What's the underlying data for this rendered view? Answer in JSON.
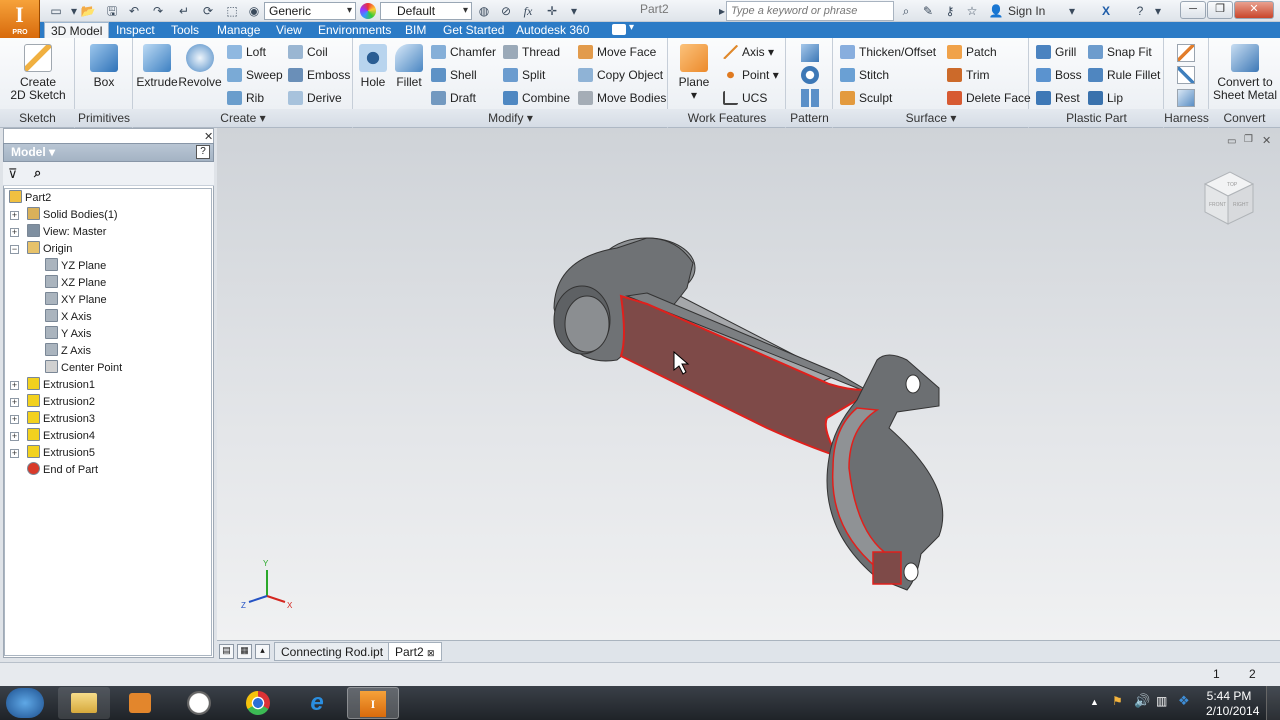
{
  "app": {
    "logo": "I",
    "logo_sub": "PRO",
    "doc_title": "Part2"
  },
  "quick_access": {
    "material": "Generic",
    "appearance": "Default",
    "search_placeholder": "Type a keyword or phrase",
    "sign_in": "Sign In"
  },
  "tabs": [
    "3D Model",
    "Inspect",
    "Tools",
    "Manage",
    "View",
    "Environments",
    "BIM",
    "Get Started",
    "Autodesk 360"
  ],
  "active_tab": "3D Model",
  "ribbon": {
    "sketch": {
      "label": "Sketch",
      "create": "Create\n2D Sketch"
    },
    "primitives": {
      "label": "Primitives",
      "box": "Box"
    },
    "create": {
      "label": "Create",
      "extrude": "Extrude",
      "revolve": "Revolve",
      "loft": "Loft",
      "sweep": "Sweep",
      "rib": "Rib",
      "coil": "Coil",
      "emboss": "Emboss",
      "derive": "Derive"
    },
    "modify": {
      "label": "Modify",
      "hole": "Hole",
      "fillet": "Fillet",
      "chamfer": "Chamfer",
      "shell": "Shell",
      "draft": "Draft",
      "thread": "Thread",
      "split": "Split",
      "combine": "Combine",
      "move_face": "Move Face",
      "copy_object": "Copy Object",
      "move_bodies": "Move Bodies"
    },
    "work": {
      "label": "Work Features",
      "plane": "Plane",
      "axis": "Axis",
      "point": "Point",
      "ucs": "UCS"
    },
    "pattern": {
      "label": "Pattern"
    },
    "surface": {
      "label": "Surface",
      "thicken": "Thicken/Offset",
      "stitch": "Stitch",
      "sculpt": "Sculpt",
      "patch": "Patch",
      "trim": "Trim",
      "delete_face": "Delete Face"
    },
    "plastic": {
      "label": "Plastic Part",
      "grill": "Grill",
      "boss": "Boss",
      "rest": "Rest",
      "snap_fit": "Snap Fit",
      "rule_fillet": "Rule Fillet",
      "lip": "Lip"
    },
    "harness": {
      "label": "Harness"
    },
    "convert": {
      "label": "Convert",
      "sheet_metal": "Convert to\nSheet Metal"
    }
  },
  "browser": {
    "title": "Model",
    "tree": [
      {
        "label": "Part2",
        "level": 0
      },
      {
        "label": "Solid Bodies(1)",
        "level": 1
      },
      {
        "label": "View: Master",
        "level": 1
      },
      {
        "label": "Origin",
        "level": 1
      },
      {
        "label": "YZ Plane",
        "level": 2
      },
      {
        "label": "XZ Plane",
        "level": 2
      },
      {
        "label": "XY Plane",
        "level": 2
      },
      {
        "label": "X Axis",
        "level": 2
      },
      {
        "label": "Y Axis",
        "level": 2
      },
      {
        "label": "Z Axis",
        "level": 2
      },
      {
        "label": "Center Point",
        "level": 2
      },
      {
        "label": "Extrusion1",
        "level": 1
      },
      {
        "label": "Extrusion2",
        "level": 1
      },
      {
        "label": "Extrusion3",
        "level": 1
      },
      {
        "label": "Extrusion4",
        "level": 1
      },
      {
        "label": "Extrusion5",
        "level": 1
      },
      {
        "label": "End of Part",
        "level": 1
      }
    ]
  },
  "viewcube": {
    "top": "TOP",
    "front": "FRONT",
    "right": "RIGHT"
  },
  "triad": {
    "x": "X",
    "y": "Y",
    "z": "Z"
  },
  "doc_tabs": [
    "Connecting Rod.ipt",
    "Part2"
  ],
  "status": {
    "page1": "1",
    "page2": "2"
  },
  "taskbar": {
    "time": "5:44 PM",
    "date": "2/10/2014"
  },
  "colors": {
    "accent": "#2c7bc6",
    "selection": "#e0201c",
    "face_fill": "#7e4a48"
  }
}
